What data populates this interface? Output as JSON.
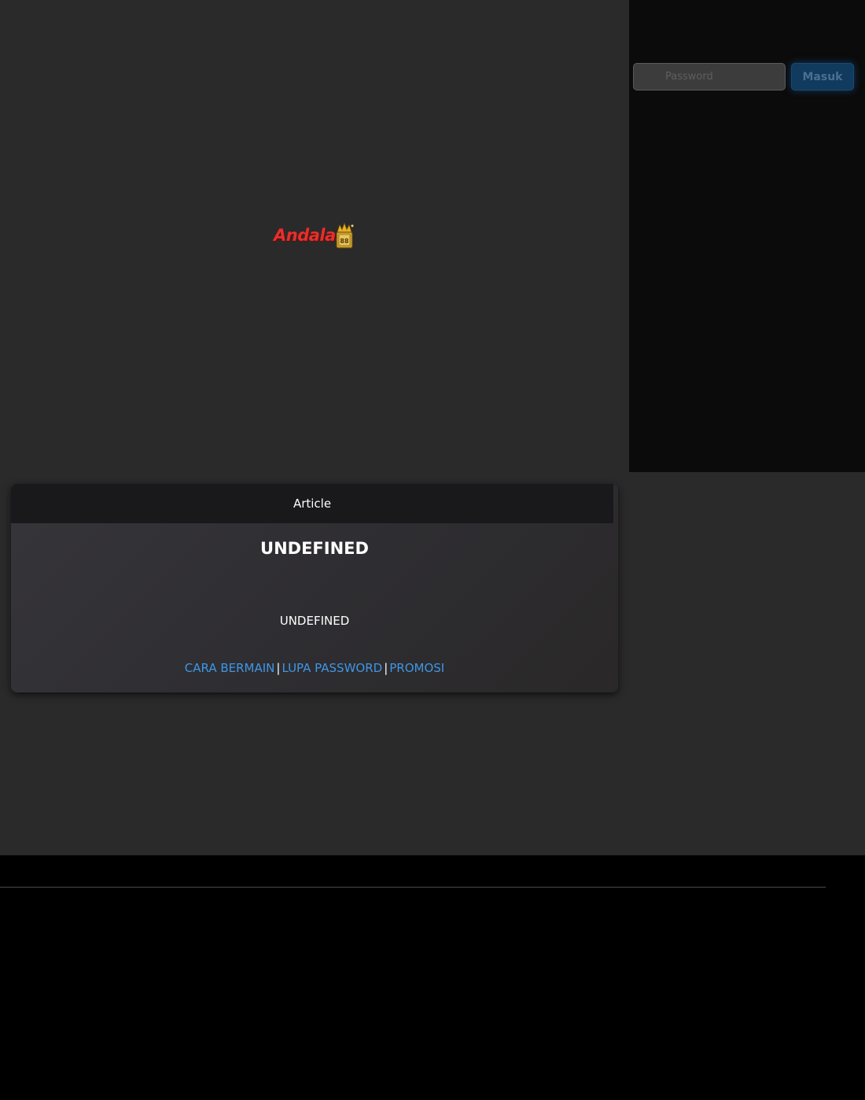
{
  "login": {
    "password_placeholder": "Password",
    "submit_label": "Masuk"
  },
  "brand": {
    "logo_text": "Andalas",
    "logo_badge_text": "88"
  },
  "article": {
    "header_label": "Article",
    "title": "UNDEFINED",
    "body": "UNDEFINED",
    "links": {
      "how_to_play": "CARA BERMAIN",
      "forgot_password": "LUPA PASSWORD",
      "promotion": "PROMOSI",
      "separator": "|"
    }
  },
  "colors": {
    "page_background": "#2a2a2a",
    "login_panel_background": "#0b0b0b",
    "accent_link": "#3f96e6",
    "button_background": "#103a5e",
    "logo_red": "#e5302c",
    "logo_gold": "#d9a52b"
  }
}
